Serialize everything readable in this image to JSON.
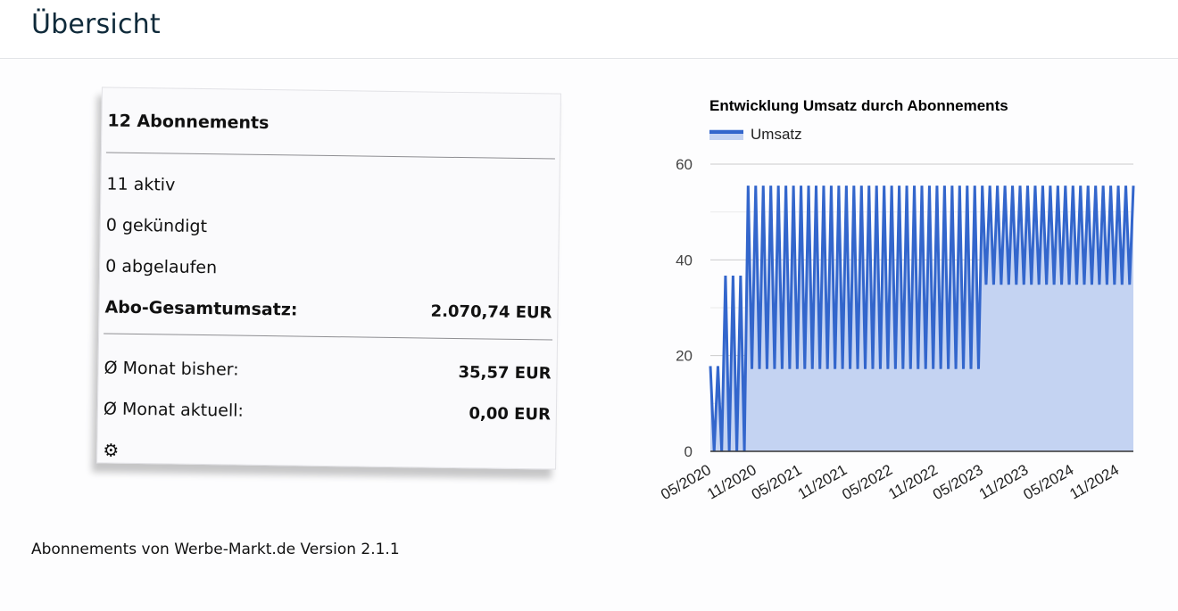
{
  "page": {
    "title": "Übersicht"
  },
  "card": {
    "heading": "12 Abonnements",
    "active": "11 aktiv",
    "cancelled": "0 gekündigt",
    "expired": "0 abgelaufen",
    "total_label": "Abo-Gesamtumsatz:",
    "total_value": "2.070,74 EUR",
    "avg_past_label": "Ø Monat bisher:",
    "avg_past_value": "35,57 EUR",
    "avg_current_label": "Ø Monat aktuell:",
    "avg_current_value": "0,00 EUR",
    "settings_icon": "⚙"
  },
  "footer": {
    "text": "Abonnements von Werbe-Markt.de Version 2.1.1"
  },
  "colors": {
    "series_line": "#3366cc",
    "series_area": "#c4d3f2"
  },
  "chart_data": {
    "type": "area",
    "title": "Entwicklung Umsatz durch Abonnements",
    "legend": {
      "position": "top-left",
      "entries": [
        "Umsatz"
      ]
    },
    "xlabel": "",
    "ylabel": "",
    "ylim": [
      0,
      60
    ],
    "yticks": [
      0,
      20,
      40,
      60
    ],
    "grid": true,
    "xtick_labels": [
      "05/2020",
      "11/2020",
      "05/2021",
      "11/2021",
      "05/2022",
      "11/2022",
      "05/2023",
      "11/2023",
      "05/2024",
      "11/2024"
    ],
    "x_start": "05/2020",
    "series": [
      {
        "name": "Umsatz",
        "values": [
          17.8,
          0,
          17.8,
          0,
          36.7,
          0,
          36.7,
          0,
          36.7,
          0,
          55.5,
          17.2,
          55.5,
          17.2,
          55.5,
          17.2,
          55.5,
          17.2,
          55.5,
          17.2,
          55.5,
          17.2,
          55.5,
          17.2,
          55.5,
          17.2,
          55.5,
          17.2,
          55.5,
          17.2,
          55.5,
          17.2,
          55.5,
          17.2,
          55.5,
          17.2,
          55.5,
          17.2,
          55.5,
          17.2,
          55.5,
          17.2,
          55.5,
          17.2,
          55.5,
          17.2,
          55.5,
          17.2,
          55.5,
          17.2,
          55.5,
          17.2,
          55.5,
          17.2,
          55.5,
          17.2,
          55.5,
          17.2,
          55.5,
          17.2,
          55.5,
          17.2,
          55.5,
          17.2,
          55.5,
          17.2,
          55.5,
          17.2,
          55.5,
          17.2,
          55.5,
          17.2,
          55.5,
          34.8,
          55.5,
          34.8,
          55.5,
          34.8,
          55.5,
          34.8,
          55.5,
          34.8,
          55.5,
          34.8,
          55.5,
          34.8,
          55.5,
          34.8,
          55.5,
          34.8,
          55.5,
          34.8,
          55.5,
          34.8,
          55.5,
          34.8,
          55.5,
          34.8,
          55.5,
          34.8,
          55.5,
          34.8,
          55.5,
          34.8,
          55.5,
          34.8,
          55.5,
          34.8,
          55.5,
          34.8,
          55.5,
          34.8,
          55.5
        ]
      }
    ]
  }
}
